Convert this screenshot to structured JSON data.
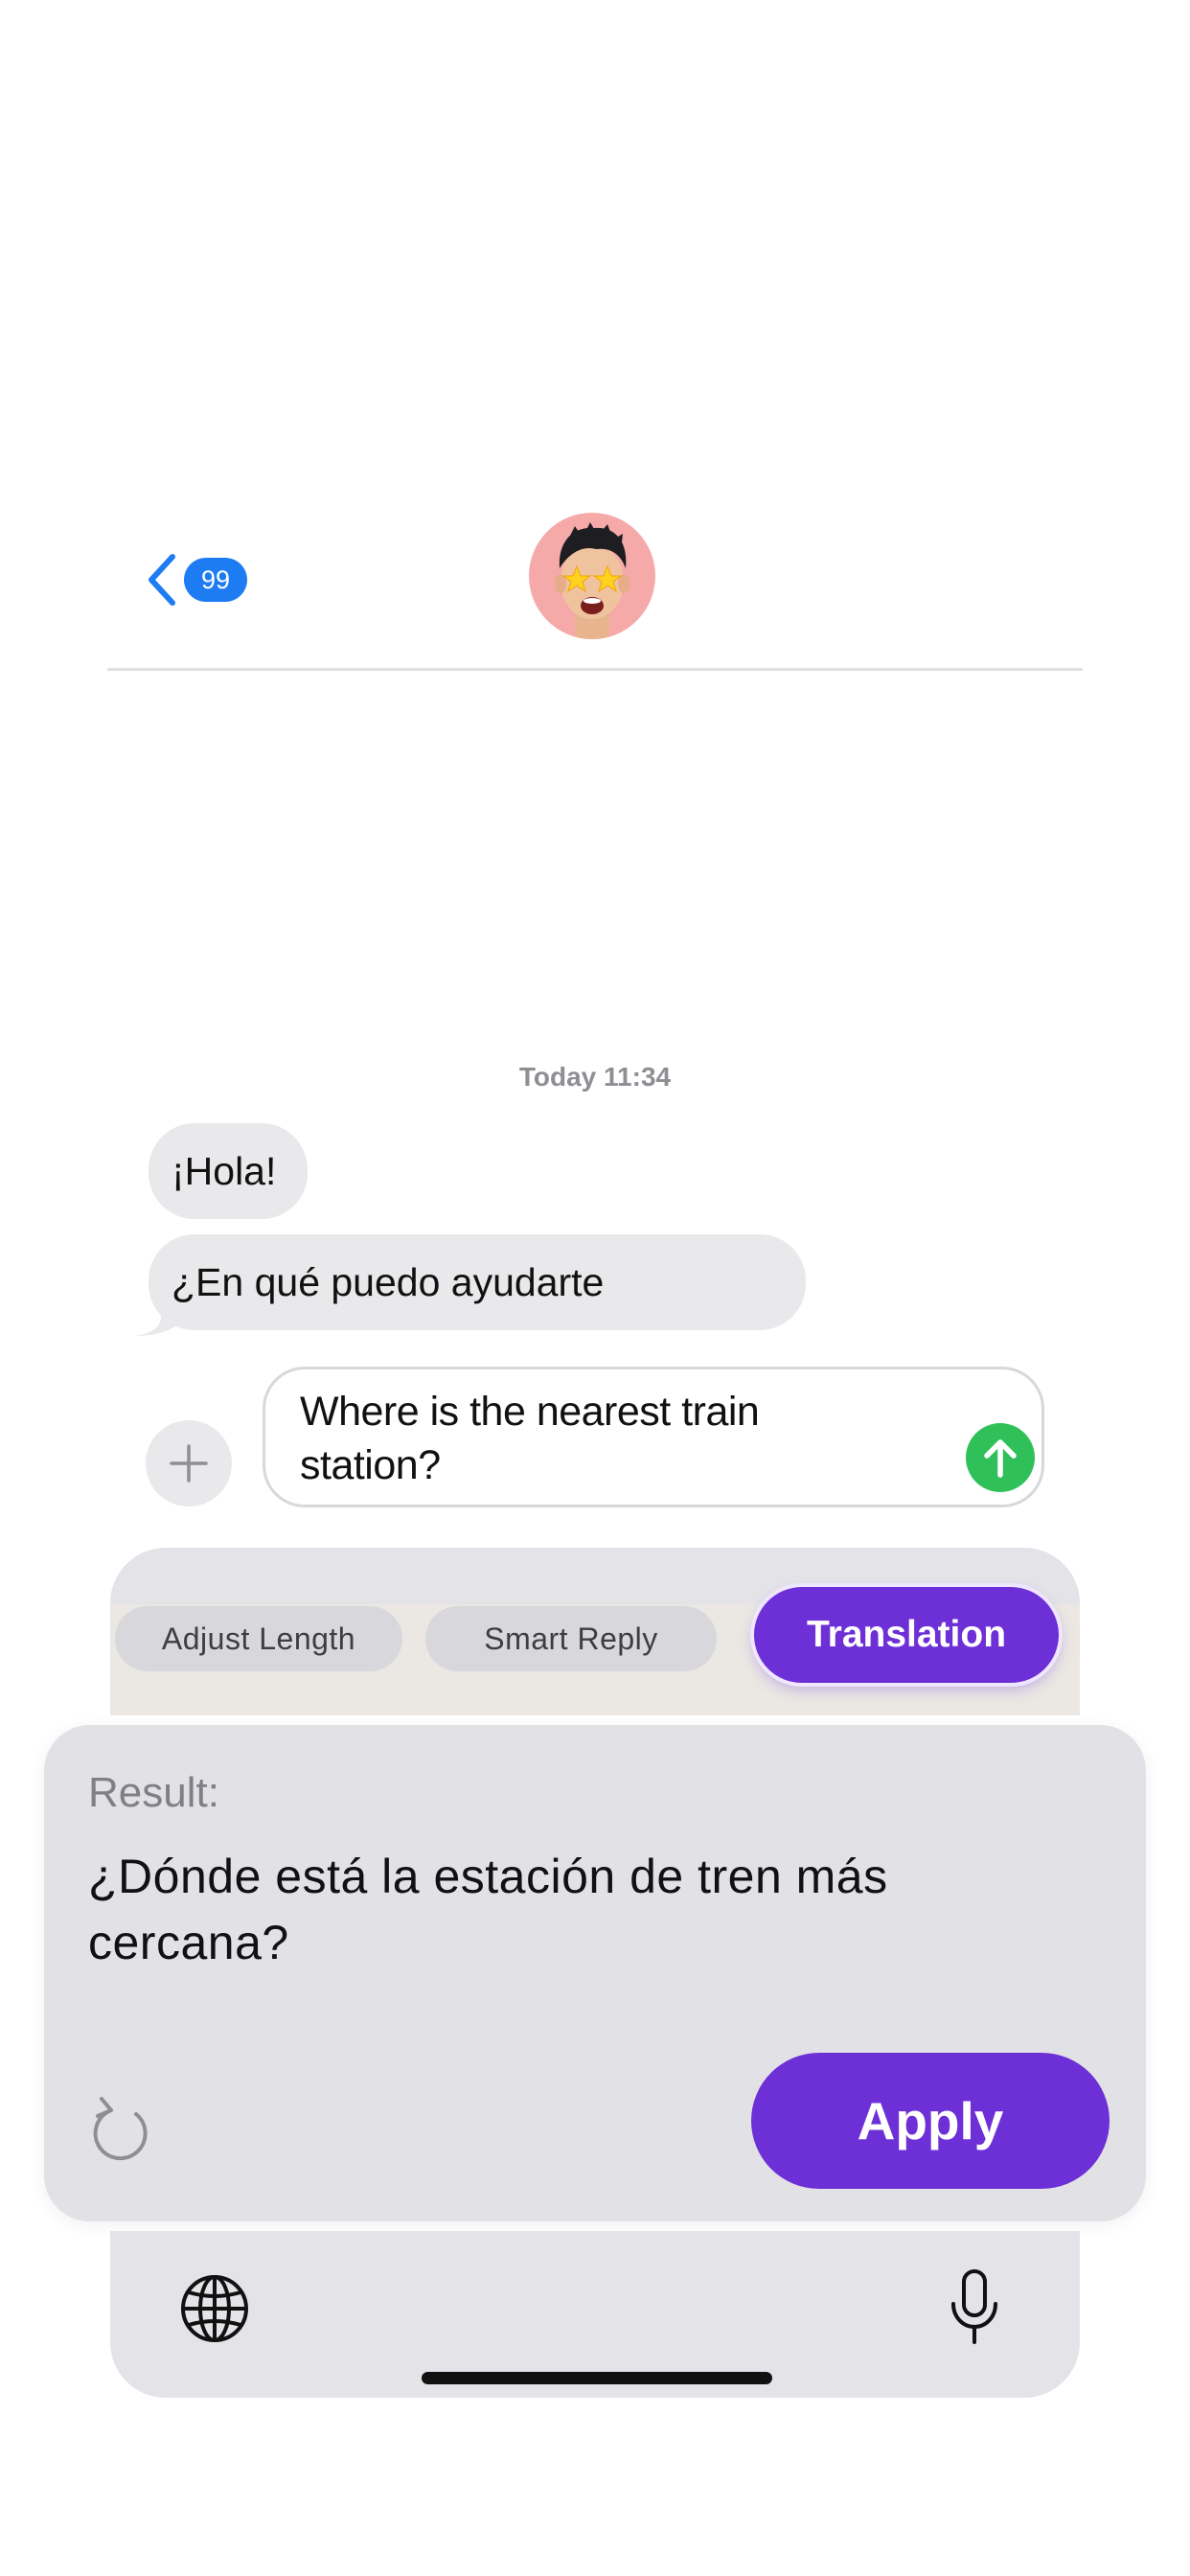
{
  "header": {
    "unread_count": "99",
    "icons": {
      "back": "chevron-left-icon",
      "avatar": "memoji-avatar"
    },
    "accent_color": "#1e7cf2"
  },
  "conversation": {
    "timestamp": "Today 11:34",
    "messages": [
      {
        "direction": "incoming",
        "text": "¡Hola!"
      },
      {
        "direction": "incoming",
        "text": "¿En qué puedo ayudarte"
      }
    ]
  },
  "compose": {
    "text": "Where is the nearest train station?",
    "icons": {
      "attach": "plus-icon",
      "send": "arrow-up-icon"
    },
    "send_color": "#30c05a"
  },
  "assistant": {
    "tabs": [
      {
        "label": "Adjust Length",
        "active": false
      },
      {
        "label": "Smart Reply",
        "active": false
      },
      {
        "label": "Translation",
        "active": true
      }
    ],
    "result_label": "Result:",
    "result_text": "¿Dónde está la estación de tren más cercana?",
    "apply_label": "Apply",
    "accent_color": "#6d2fd6",
    "icons": {
      "refresh": "refresh-icon"
    }
  },
  "keyboard": {
    "icons": {
      "language": "globe-icon",
      "dictation": "microphone-icon"
    }
  }
}
